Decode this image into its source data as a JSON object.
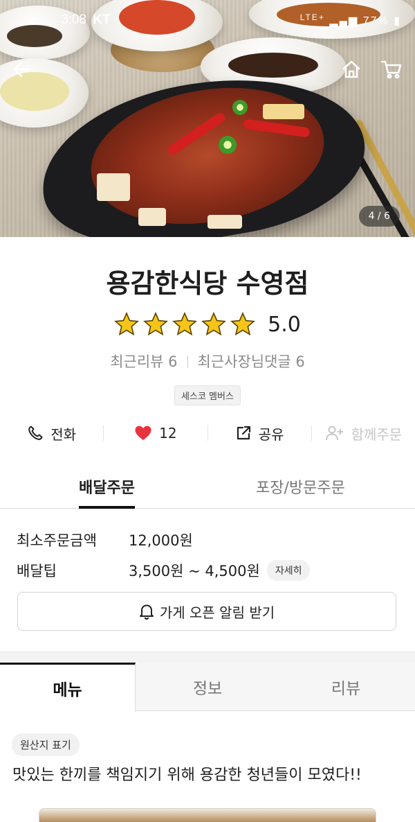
{
  "status_bar": {
    "time": "3:08",
    "carrier": "KT",
    "network": "LTE+",
    "battery": "77%"
  },
  "hero": {
    "image_counter": "4 / 6"
  },
  "icons": {
    "back": "back-arrow-icon",
    "home": "home-icon",
    "cart": "cart-icon",
    "phone": "phone-icon",
    "heart": "heart-icon",
    "share": "share-icon",
    "group_order": "add-person-icon",
    "bell": "bell-icon",
    "star": "star-icon"
  },
  "store": {
    "name": "용감한식당 수영점",
    "rating": "5.0",
    "stars": 5,
    "recent_reviews_label": "최근리뷰 6",
    "owner_replies_label": "최근사장님댓글 6",
    "member_badge": "세스코 멤버스"
  },
  "actions": {
    "call": "전화",
    "likes": "12",
    "share": "공유",
    "group_order": "함께주문"
  },
  "order_tabs": {
    "delivery": "배달주문",
    "pickup": "포장/방문주문"
  },
  "delivery_info": {
    "min_order_label": "최소주문금액",
    "min_order_value": "12,000원",
    "tip_label": "배달팁",
    "tip_value": "3,500원 ~ 4,500원",
    "detail_chip": "자세히",
    "notify_button": "가게 오픈 알림 받기"
  },
  "menu_tabs": {
    "menu": "메뉴",
    "info": "정보",
    "review": "리뷰"
  },
  "menu_section": {
    "origin_chip": "원산지 표기",
    "intro": "맛있는 한끼를 책임지기 위해 용감한 청년들이 모였다!!"
  },
  "colors": {
    "heart": "#e8343e",
    "star_fill": "#f5c518",
    "star_stroke": "#5a4300",
    "text_primary": "#1e1e1e",
    "text_muted": "#8a8a8a"
  }
}
